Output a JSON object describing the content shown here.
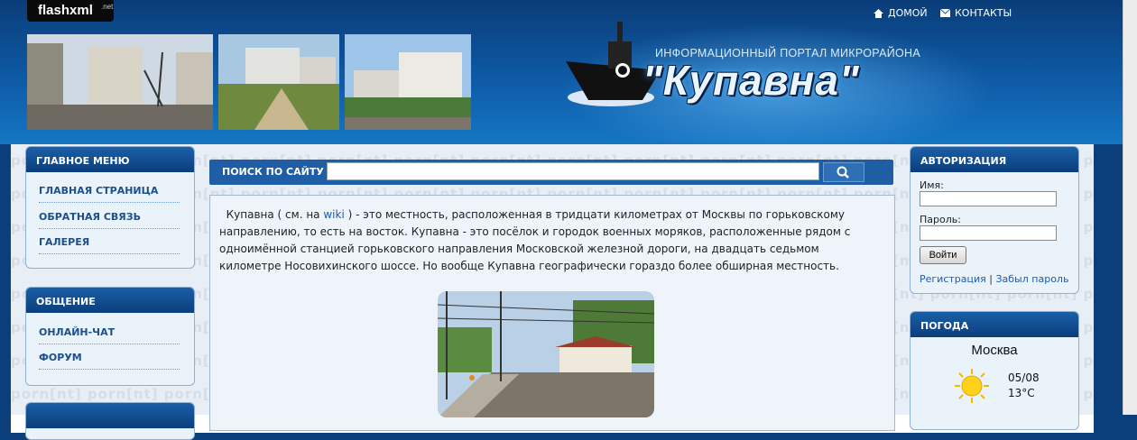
{
  "header": {
    "logo_brand": "flashxml",
    "logo_tld": ".net",
    "nav_home": "ДОМОЙ",
    "nav_contacts": "КОНТАКТЫ",
    "portal_title": "ИНФОРМАЦИОННЫЙ ПОРТАЛ МИКРОРАЙОНА",
    "site_name": "\"Купавна\""
  },
  "watermark": "porn[nt]",
  "main_menu": {
    "title": "ГЛАВНОЕ МЕНЮ",
    "items": [
      {
        "label": "ГЛАВНАЯ СТРАНИЦА"
      },
      {
        "label": "ОБРАТНАЯ СВЯЗЬ"
      },
      {
        "label": "ГАЛЕРЕЯ"
      }
    ]
  },
  "communication_menu": {
    "title": "ОБЩЕНИЕ",
    "items": [
      {
        "label": "ОНЛАЙН-ЧАТ"
      },
      {
        "label": "ФОРУМ"
      }
    ]
  },
  "search": {
    "label": "ПОИСК ПО САЙТУ",
    "value": ""
  },
  "article": {
    "text_before_link": "Купавна ( см. на ",
    "link_text": "wiki",
    "text_after_link": " ) - это местность, расположенная в тридцати километрах от Москвы по горьковскому направлению, то есть на восток. Купавна - это посёлок и городок военных моряков, расположенные рядом с одноимённой станцией горьковского направления Московской железной дороги, на двадцать седьмом километре Носовихинского шоссе. Но вообще Купавна географически гораздо более обширная местность."
  },
  "auth": {
    "title": "АВТОРИЗАЦИЯ",
    "name_label": "Имя:",
    "password_label": "Пароль:",
    "login_button": "Войти",
    "register_link": "Регистрация",
    "separator": "|",
    "forgot_link": "Забыл пароль"
  },
  "weather": {
    "title": "ПОГОДА",
    "city": "Москва",
    "date": "05/08",
    "temperature": "13°C"
  }
}
